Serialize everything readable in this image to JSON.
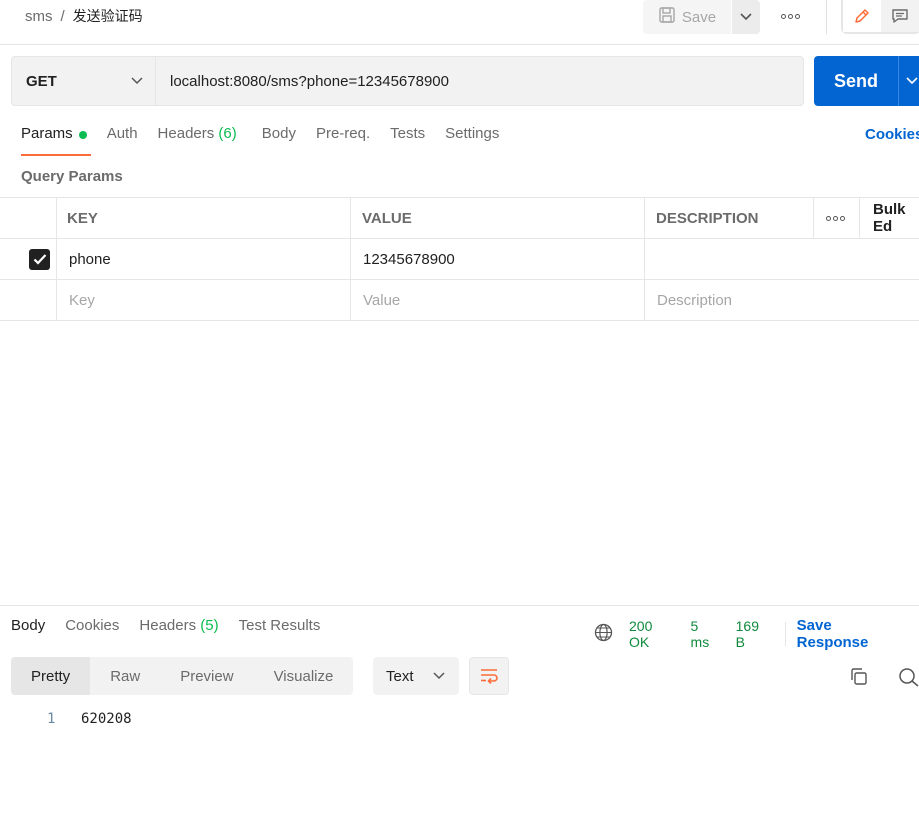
{
  "breadcrumb": {
    "parent": "sms",
    "separator": "/",
    "current": "发送验证码"
  },
  "toolbar": {
    "save_label": "Save"
  },
  "request": {
    "method": "GET",
    "url": "localhost:8080/sms?phone=12345678900",
    "send_label": "Send"
  },
  "request_tabs": [
    {
      "label": "Params",
      "active": true
    },
    {
      "label": "Auth"
    },
    {
      "label": "Headers",
      "count": "(6)"
    },
    {
      "label": "Body"
    },
    {
      "label": "Pre-req."
    },
    {
      "label": "Tests"
    },
    {
      "label": "Settings"
    }
  ],
  "cookies_link": "Cookies",
  "query_params": {
    "title": "Query Params",
    "columns": {
      "key": "KEY",
      "value": "VALUE",
      "description": "DESCRIPTION",
      "bulk_edit": "Bulk Ed"
    },
    "rows": [
      {
        "checked": true,
        "key": "phone",
        "value": "12345678900",
        "description": ""
      }
    ],
    "placeholder": {
      "key": "Key",
      "value": "Value",
      "description": "Description"
    }
  },
  "response": {
    "tabs": [
      {
        "label": "Body",
        "active": true
      },
      {
        "label": "Cookies"
      },
      {
        "label": "Headers",
        "count": "(5)"
      },
      {
        "label": "Test Results"
      }
    ],
    "status": "200 OK",
    "time": "5 ms",
    "size": "169 B",
    "save_label": "Save Response",
    "format_tabs": [
      "Pretty",
      "Raw",
      "Preview",
      "Visualize"
    ],
    "type_select": "Text",
    "lines": [
      {
        "num": "1",
        "text": "620208"
      }
    ]
  },
  "colors": {
    "accent": "#ff6c37",
    "primary": "#0265d2",
    "success": "#0cbb52"
  }
}
